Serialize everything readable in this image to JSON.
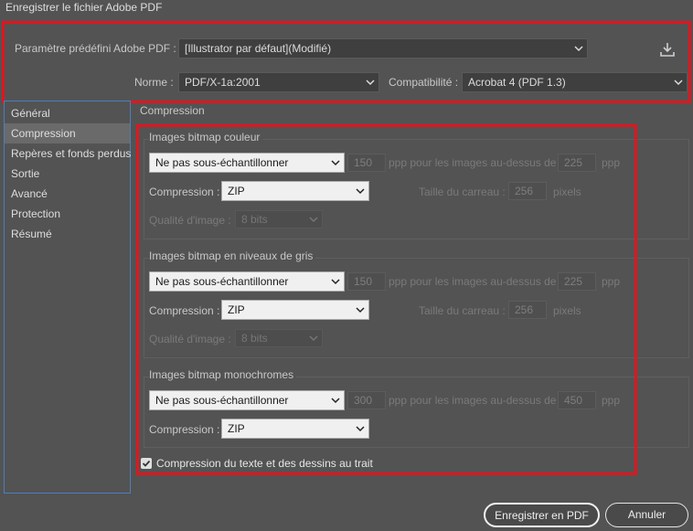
{
  "window": {
    "title": "Enregistrer le fichier Adobe PDF"
  },
  "preset": {
    "label": "Paramètre prédéfini Adobe PDF :",
    "value": "[Illustrator par défaut](Modifié)",
    "save_icon": "download-icon"
  },
  "standard": {
    "label": "Norme :",
    "value": "PDF/X-1a:2001"
  },
  "compat": {
    "label": "Compatibilité :",
    "value": "Acrobat 4 (PDF 1.3)"
  },
  "sidebar": {
    "items": [
      {
        "label": "Général"
      },
      {
        "label": "Compression"
      },
      {
        "label": "Repères et fonds perdus"
      },
      {
        "label": "Sortie"
      },
      {
        "label": "Avancé"
      },
      {
        "label": "Protection"
      },
      {
        "label": "Résumé"
      }
    ],
    "active_index": 1
  },
  "panel": {
    "title": "Compression"
  },
  "color_images": {
    "title": "Images bitmap couleur",
    "sampling": "Ne pas sous-échantillonner",
    "ppi_value": "150",
    "ppi_label": "ppp pour les images au-dessus de",
    "above_value": "225",
    "above_unit": "ppp",
    "compression_label": "Compression :",
    "compression_value": "ZIP",
    "tile_label": "Taille du carreau :",
    "tile_value": "256",
    "tile_unit": "pixels",
    "quality_label": "Qualité d'image :",
    "quality_value": "8 bits"
  },
  "gray_images": {
    "title": "Images bitmap en niveaux de gris",
    "sampling": "Ne pas sous-échantillonner",
    "ppi_value": "150",
    "ppi_label": "ppp pour les images au-dessus de",
    "above_value": "225",
    "above_unit": "ppp",
    "compression_label": "Compression :",
    "compression_value": "ZIP",
    "tile_label": "Taille du carreau :",
    "tile_value": "256",
    "tile_unit": "pixels",
    "quality_label": "Qualité d'image :",
    "quality_value": "8 bits"
  },
  "mono_images": {
    "title": "Images bitmap monochromes",
    "sampling": "Ne pas sous-échantillonner",
    "ppi_value": "300",
    "ppi_label": "ppp pour les images au-dessus de",
    "above_value": "450",
    "above_unit": "ppp",
    "compression_label": "Compression :",
    "compression_value": "ZIP"
  },
  "text_compression": {
    "label": "Compression du texte et des dessins au trait",
    "checked": true
  },
  "buttons": {
    "save": "Enregistrer en PDF",
    "cancel": "Annuler"
  },
  "colors": {
    "highlight": "#e0161f",
    "background": "#535353",
    "sidebar_border": "#4a7fc0"
  }
}
